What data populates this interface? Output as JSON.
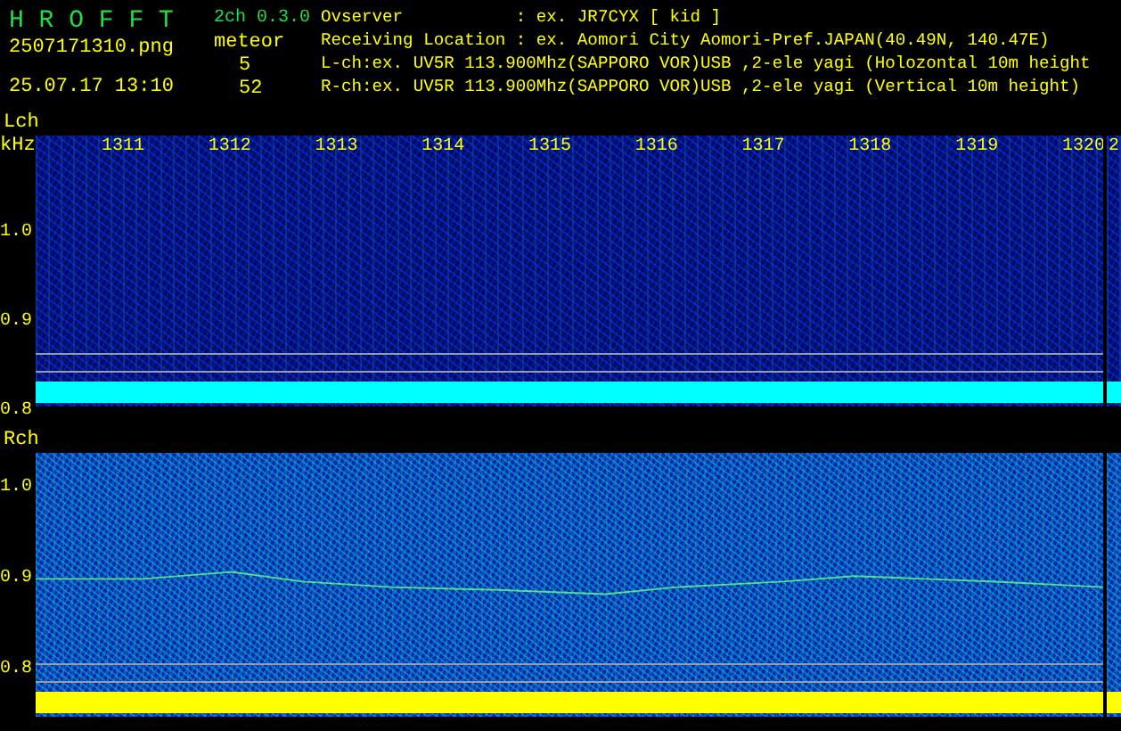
{
  "header": {
    "app_name": "H R O F F T",
    "version": "2ch 0.3.0",
    "file_name": "2507171310.png",
    "timestamp": "25.07.17 13:10",
    "count_label": "meteor",
    "counts": [
      "5",
      "52"
    ],
    "info_lines": [
      "Ovserver           : ex. JR7CYX [ kid ]",
      "Receiving Location : ex. Aomori City Aomori-Pref.JAPAN(40.49N, 140.47E)",
      "L-ch:ex. UV5R 113.900Mhz(SAPPORO VOR)USB ,2-ele yagi (Holozontal 10m height",
      "R-ch:ex. UV5R 113.900Mhz(SAPPORO VOR)USB ,2-ele yagi (Vertical 10m height)"
    ]
  },
  "panels": [
    {
      "channel": "Lch",
      "unit": "kHz",
      "y_labels": [
        "1.0",
        "0.9",
        "0.8"
      ],
      "time_labels": [
        "1311",
        "1312",
        "1313",
        "1314",
        "1315",
        "1316",
        "1317",
        "1318",
        "1319",
        "1320"
      ],
      "edge_time_label": "2",
      "color": "#00ffff",
      "trace": false
    },
    {
      "channel": "Rch",
      "y_labels": [
        "1.0",
        "0.9",
        "0.8"
      ],
      "color": "#ffff00",
      "trace": true
    }
  ]
}
